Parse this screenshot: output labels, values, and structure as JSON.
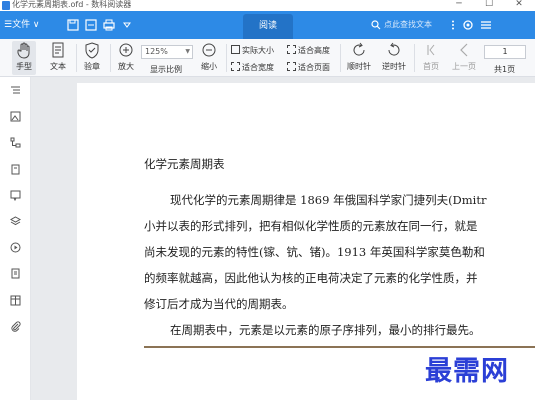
{
  "window": {
    "title": "化学元素周期表.ofd - 数科阅读器",
    "controls": {
      "minimize": "─",
      "maximize": "☐",
      "close": "✕"
    }
  },
  "menubar": {
    "file_menu": "☰文件 ∨",
    "center_tab": "阅读",
    "search_placeholder": "点此查找文本",
    "icons": [
      "save-icon",
      "page-icon",
      "print-icon",
      "dropdown-icon",
      "more-icon",
      "settings-icon",
      "menu-icon"
    ],
    "accent": "#2d8ae6"
  },
  "toolbar": {
    "hand_label": "手型",
    "text_label": "文本",
    "verify_label": "验章",
    "zoom_in_label": "放大",
    "zoom_value": "125%",
    "zoom_ratio_label": "显示比例",
    "zoom_out_label": "缩小",
    "actual_size_label": "实际大小",
    "fit_height_label": "适合高度",
    "fit_width_label": "适合宽度",
    "fit_page_label": "适合页面",
    "rotate_cw_label": "顺时针",
    "rotate_ccw_label": "逆时针",
    "first_page_label": "首页",
    "prev_page_label": "上一页",
    "page_number": "1",
    "total_pages_label": "共1页"
  },
  "sidebar": {
    "icons": [
      "outline-icon",
      "thumbnail-icon",
      "structure-icon",
      "bookmark-icon",
      "comment-icon",
      "layers-icon",
      "media-icon",
      "attachment-list-icon",
      "table-icon",
      "attachment-icon"
    ]
  },
  "document": {
    "title": "化学元素周期表",
    "lines": [
      "现代化学的元素周期律是 1869 年俄国科学家门捷列夫(Dmitr",
      "小并以表的形式排列，把有相似化学性质的元素放在同一行，就是",
      "尚未发现的元素的特性(镓、钪、锗)。1913 年英国科学家莫色勒和",
      "的频率就越高，因此他认为核的正电荷决定了元素的化学性质，并",
      "修订后才成为当代的周期表。",
      "在周期表中，元素是以元素的原子序排列，最小的排行最先。"
    ]
  },
  "watermark": {
    "text": "最需网",
    "color": "#2b3fd6"
  }
}
